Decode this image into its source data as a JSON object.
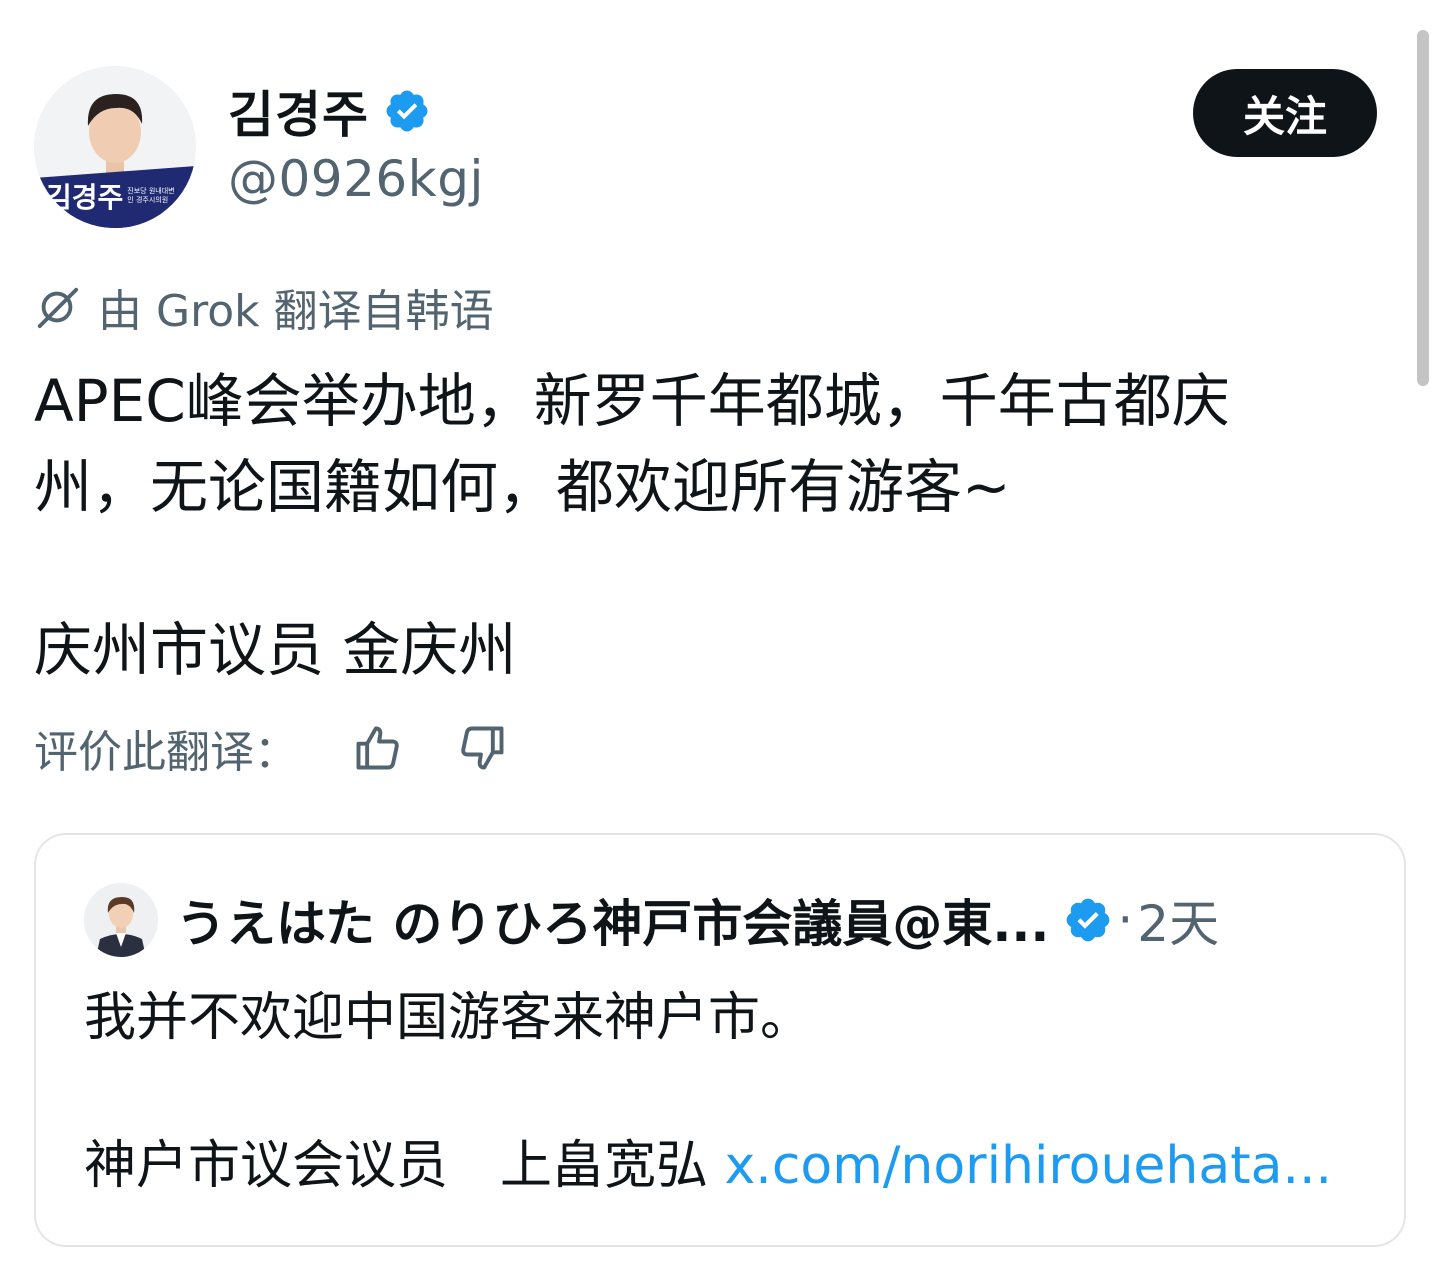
{
  "author": {
    "name": "김경주",
    "handle": "@0926kgj",
    "avatar_banner": "김경주",
    "avatar_banner_small": "진보당 원내대변인 경주시의원"
  },
  "follow_label": "关注",
  "translation": {
    "grok_label": "由 Grok 翻译自韩语"
  },
  "tweet": {
    "line1": "APEC峰会举办地，新罗千年都城，千年古都庆",
    "line2": "州，无论国籍如何，都欢迎所有游客~",
    "signature": "庆州市议员 金庆州"
  },
  "rate": {
    "label": "评价此翻译："
  },
  "quote": {
    "name": "うえはた のりひろ神戸市会議員@東...",
    "separator": "·",
    "time": "2天",
    "text": "我并不欢迎中国游客来神户市。",
    "sign_text": "神户市议会议员　上畠宽弘 ",
    "link_text": "x.com/norihirouehata..."
  },
  "colors": {
    "verified": "#1d9bf0",
    "link": "#1d9bf0",
    "secondary_text": "#536471",
    "follow_bg": "#0f1419"
  },
  "icons": [
    "verified-icon",
    "grok-icon",
    "thumbs-up-icon",
    "thumbs-down-icon"
  ]
}
